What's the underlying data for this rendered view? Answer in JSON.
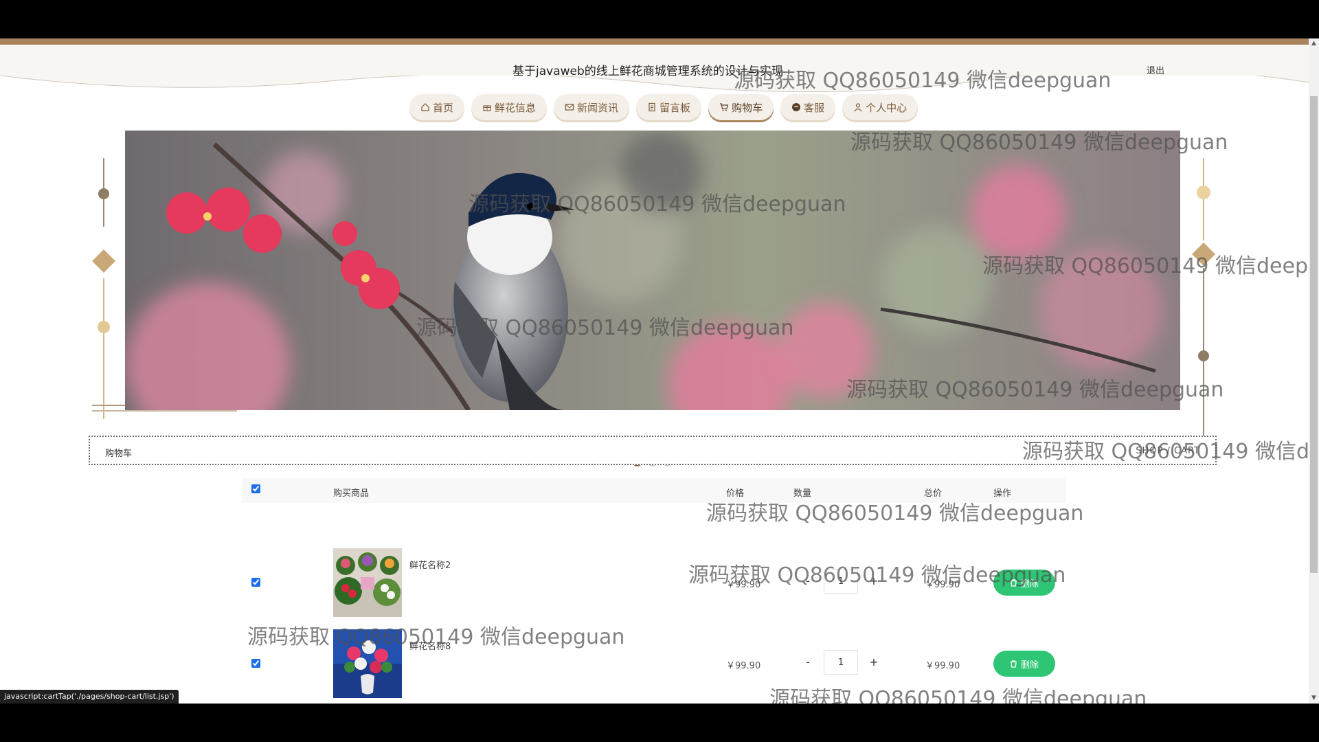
{
  "site": {
    "title": "基于javaweb的线上鲜花商城管理系统的设计与实现",
    "logout_label": "退出"
  },
  "nav": {
    "items": [
      {
        "label": "首页",
        "icon": "home-icon"
      },
      {
        "label": "鲜花信息",
        "icon": "gift-icon"
      },
      {
        "label": "新闻资讯",
        "icon": "mail-icon"
      },
      {
        "label": "留言板",
        "icon": "note-icon"
      },
      {
        "label": "购物车",
        "icon": "cart-icon",
        "active": true
      },
      {
        "label": "客服",
        "icon": "chat-icon"
      },
      {
        "label": "个人中心",
        "icon": "user-icon"
      }
    ]
  },
  "carousel": {
    "slide_count": 3,
    "active_index": 0
  },
  "section": {
    "title": "购物车",
    "subtitle": "SHOP / CART"
  },
  "cart": {
    "headers": {
      "product": "购买商品",
      "price": "价格",
      "quantity": "数量",
      "total": "总价",
      "action": "操作"
    },
    "items": [
      {
        "name": "鲜花名称2",
        "price": "￥99.90",
        "qty": "1",
        "total": "￥99.90",
        "delete_label": "删除",
        "checked": true
      },
      {
        "name": "鲜花名称8",
        "price": "￥99.90",
        "qty": "1",
        "total": "￥99.90",
        "delete_label": "删除",
        "checked": true
      }
    ],
    "minus_label": "-",
    "plus_label": "+"
  },
  "status_url": "javascript:cartTap('./pages/shop-cart/list.jsp')",
  "watermark_text": "源码获取 QQ86050149 微信deepguan",
  "colors": {
    "accent_brown": "#a8845d",
    "delete_green": "#2ec674",
    "checkbox_blue": "#1c6ee8"
  }
}
